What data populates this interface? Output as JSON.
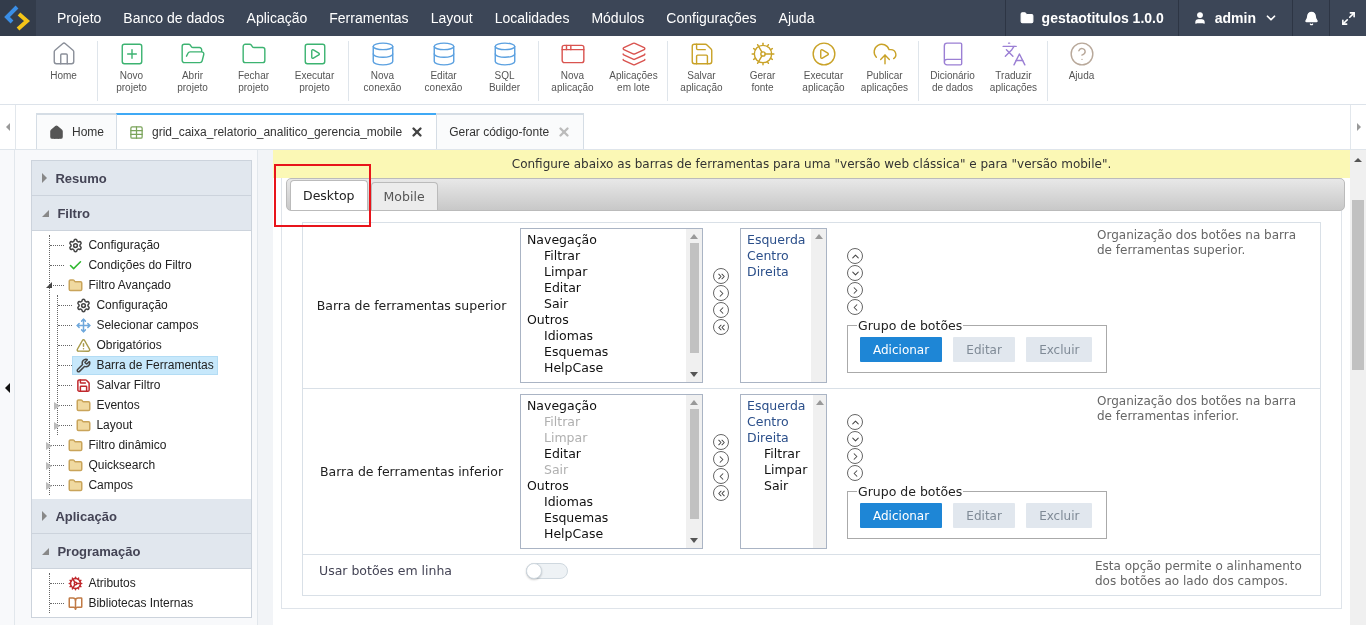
{
  "menu": {
    "items": [
      "Projeto",
      "Banco de dados",
      "Aplicação",
      "Ferramentas",
      "Layout",
      "Localidades",
      "Módulos",
      "Configurações",
      "Ajuda"
    ],
    "project": "gestaotitulos 1.0.0",
    "user": "admin"
  },
  "toolbar": {
    "groups": [
      {
        "items": [
          "Home"
        ]
      },
      {
        "items": [
          "Novo\nprojeto",
          "Abrir\nprojeto",
          "Fechar\nprojeto",
          "Executar\nprojeto"
        ]
      },
      {
        "items": [
          "Nova\nconexão",
          "Editar\nconexão",
          "SQL\nBuilder"
        ]
      },
      {
        "items": [
          "Nova\naplicação",
          "Aplicações\nem lote"
        ]
      },
      {
        "items": [
          "Salvar\naplicação",
          "Gerar\nfonte",
          "Executar\naplicação",
          "Publicar\naplicações"
        ]
      },
      {
        "items": [
          "Dicionário\nde dados",
          "Traduzir\naplicações"
        ]
      },
      {
        "items": [
          "Ajuda"
        ]
      }
    ]
  },
  "doc_tabs": [
    {
      "label": "Home",
      "kind": "home",
      "selected": false
    },
    {
      "label": "grid_caixa_relatorio_analitico_gerencia_mobile",
      "kind": "grid",
      "selected": true
    },
    {
      "label": "Gerar código-fonte",
      "kind": "plain",
      "selected": false
    }
  ],
  "sidebar": {
    "sections": [
      {
        "title": "Resumo",
        "expanded": false
      },
      {
        "title": "Filtro",
        "expanded": true,
        "items": [
          {
            "label": "Configuração",
            "kind": "gear",
            "selected": false
          },
          {
            "label": "Condições do Filtro",
            "kind": "check",
            "selected": false
          },
          {
            "label": "Filtro Avançado",
            "kind": "folder",
            "selected": false,
            "expanded": true,
            "children": [
              {
                "label": "Configuração",
                "kind": "gear",
                "selected": false
              },
              {
                "label": "Selecionar campos",
                "kind": "move",
                "selected": false
              },
              {
                "label": "Obrigatórios",
                "kind": "warning",
                "selected": false
              },
              {
                "label": "Barra de Ferramentas",
                "kind": "wrench",
                "selected": true
              },
              {
                "label": "Salvar Filtro",
                "kind": "save",
                "selected": false
              },
              {
                "label": "Eventos",
                "kind": "folder",
                "selected": false,
                "expanded": false
              },
              {
                "label": "Layout",
                "kind": "folder",
                "selected": false,
                "expanded": false
              }
            ]
          },
          {
            "label": "Filtro dinâmico",
            "kind": "folder",
            "selected": false,
            "expanded": false
          },
          {
            "label": "Quicksearch",
            "kind": "folder",
            "selected": false,
            "expanded": false
          },
          {
            "label": "Campos",
            "kind": "folder",
            "selected": false,
            "expanded": false
          }
        ]
      },
      {
        "title": "Aplicação",
        "expanded": false
      },
      {
        "title": "Programação",
        "expanded": true,
        "items": [
          {
            "label": "Atributos",
            "kind": "cogs",
            "selected": false
          },
          {
            "label": "Bibliotecas Internas",
            "kind": "library",
            "selected": false
          }
        ]
      }
    ]
  },
  "content": {
    "banner": "Configure abaixo as barras de ferramentas para uma \"versão web clássica\" e para \"versão mobile\".",
    "tabs": [
      {
        "label": "Desktop",
        "selected": true,
        "highlighted": true
      },
      {
        "label": "Mobile",
        "selected": false,
        "highlighted": false
      }
    ],
    "rows": [
      {
        "kind": "toolbar",
        "label": "Barra de ferramentas superior",
        "available": [
          {
            "label": "Navegação",
            "children": [
              {
                "label": "Filtrar",
                "disabled": false
              },
              {
                "label": "Limpar",
                "disabled": false
              },
              {
                "label": "Editar",
                "disabled": false
              },
              {
                "label": "Sair",
                "disabled": false
              }
            ]
          },
          {
            "label": "Outros",
            "children": [
              {
                "label": "Idiomas",
                "disabled": false
              },
              {
                "label": "Esquemas",
                "disabled": false
              },
              {
                "label": "HelpCase",
                "disabled": false
              }
            ]
          }
        ],
        "placed": [
          {
            "label": "Esquerda"
          },
          {
            "label": "Centro"
          },
          {
            "label": "Direita"
          }
        ],
        "group": {
          "legend": "Grupo de botões",
          "buttons": [
            {
              "label": "Adicionar",
              "disabled": false
            },
            {
              "label": "Editar",
              "disabled": true
            },
            {
              "label": "Excluir",
              "disabled": true
            }
          ]
        },
        "help": "Organização dos botões na barra de ferramentas superior."
      },
      {
        "kind": "toolbar",
        "label": "Barra de ferramentas inferior",
        "available": [
          {
            "label": "Navegação",
            "children": [
              {
                "label": "Filtrar",
                "disabled": true
              },
              {
                "label": "Limpar",
                "disabled": true
              },
              {
                "label": "Editar",
                "disabled": false
              },
              {
                "label": "Sair",
                "disabled": true
              }
            ]
          },
          {
            "label": "Outros",
            "children": [
              {
                "label": "Idiomas",
                "disabled": false
              },
              {
                "label": "Esquemas",
                "disabled": false
              },
              {
                "label": "HelpCase",
                "disabled": false
              }
            ]
          }
        ],
        "placed": [
          {
            "label": "Esquerda"
          },
          {
            "label": "Centro"
          },
          {
            "label": "Direita",
            "children": [
              {
                "label": "Filtrar"
              },
              {
                "label": "Limpar"
              },
              {
                "label": "Sair"
              }
            ]
          }
        ],
        "group": {
          "legend": "Grupo de botões",
          "buttons": [
            {
              "label": "Adicionar",
              "disabled": false
            },
            {
              "label": "Editar",
              "disabled": true
            },
            {
              "label": "Excluir",
              "disabled": true
            }
          ]
        },
        "help": "Organização dos botões na barra de ferramentas inferior."
      },
      {
        "kind": "switch",
        "label": "Usar botões em linha",
        "on": false,
        "help": "Esta opção permite o alinhamento dos botões ao lado dos campos."
      }
    ]
  }
}
